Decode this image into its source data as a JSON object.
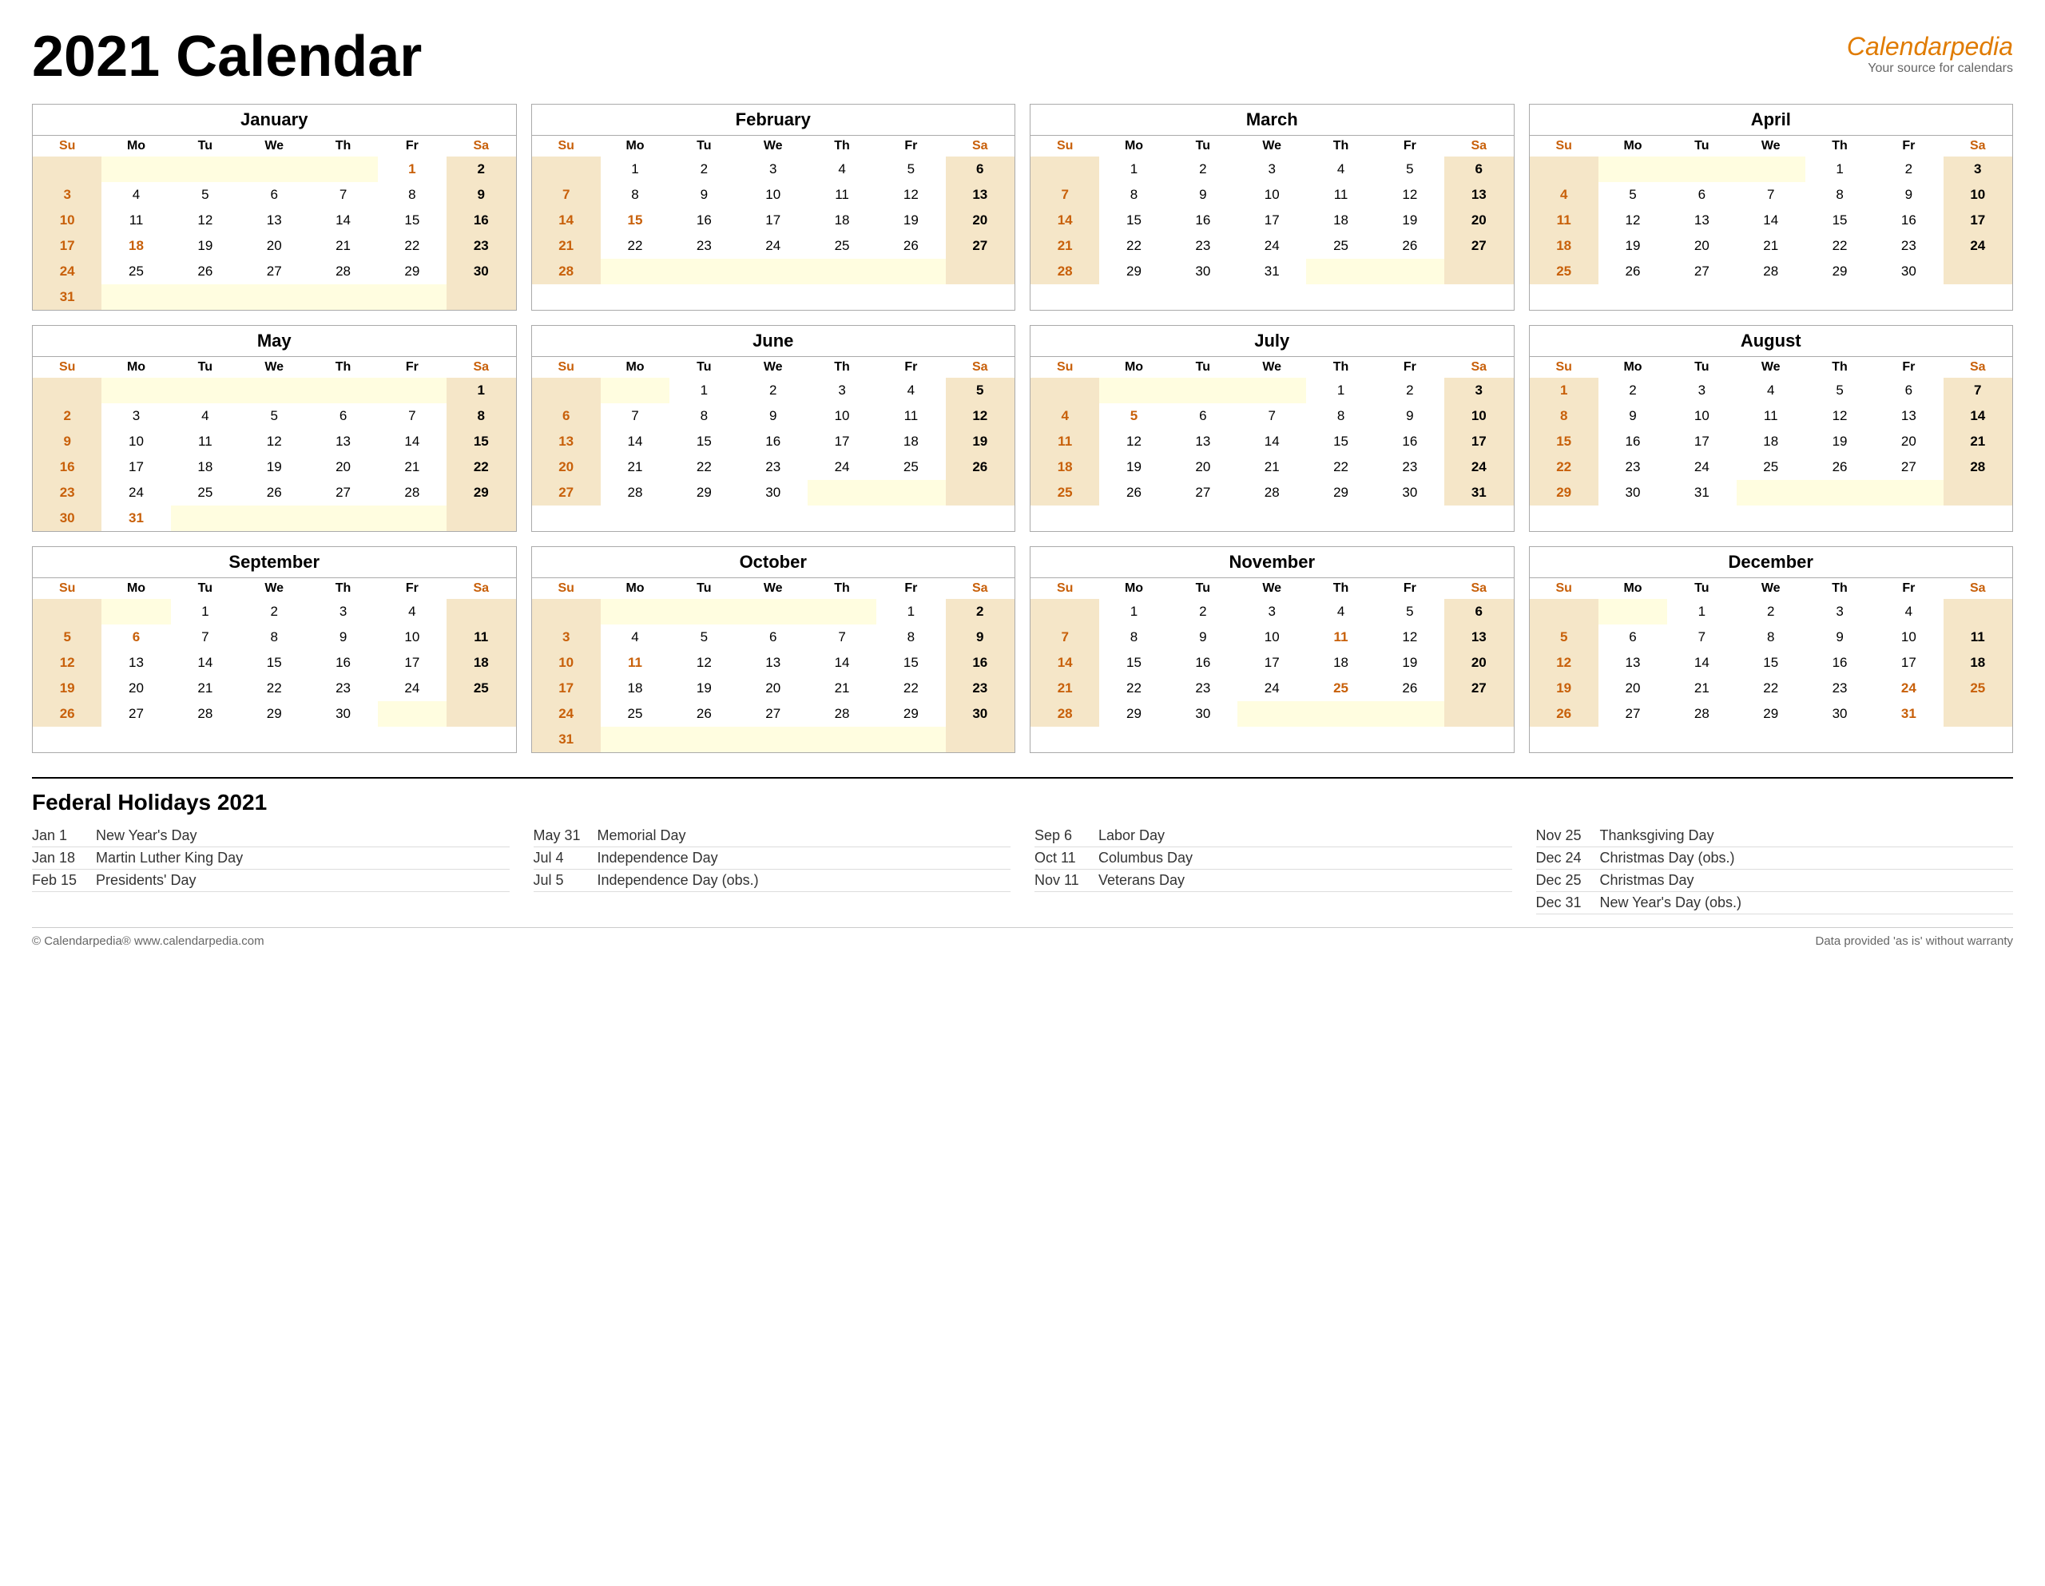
{
  "header": {
    "title": "2021 Calendar",
    "brand_name": "Calendar",
    "brand_italic": "pedia",
    "brand_sub": "Your source for calendars"
  },
  "months": [
    {
      "name": "January",
      "weeks": [
        [
          "",
          "",
          "",
          "",
          "",
          "1",
          "2"
        ],
        [
          "3",
          "4",
          "5",
          "6",
          "7",
          "8",
          "9"
        ],
        [
          "10",
          "11",
          "12",
          "13",
          "14",
          "15",
          "16"
        ],
        [
          "17",
          "18",
          "19",
          "20",
          "21",
          "22",
          "23"
        ],
        [
          "24",
          "25",
          "26",
          "27",
          "28",
          "29",
          "30"
        ],
        [
          "31",
          "",
          "",
          "",
          "",
          "",
          ""
        ]
      ],
      "holidays": {
        "1": "NY",
        "18": "MLK"
      }
    },
    {
      "name": "February",
      "weeks": [
        [
          "",
          "1",
          "2",
          "3",
          "4",
          "5",
          "6"
        ],
        [
          "7",
          "8",
          "9",
          "10",
          "11",
          "12",
          "13"
        ],
        [
          "14",
          "15",
          "16",
          "17",
          "18",
          "19",
          "20"
        ],
        [
          "21",
          "22",
          "23",
          "24",
          "25",
          "26",
          "27"
        ],
        [
          "28",
          "",
          "",
          "",
          "",
          "",
          ""
        ]
      ],
      "holidays": {
        "15": "PD"
      }
    },
    {
      "name": "March",
      "weeks": [
        [
          "",
          "1",
          "2",
          "3",
          "4",
          "5",
          "6"
        ],
        [
          "7",
          "8",
          "9",
          "10",
          "11",
          "12",
          "13"
        ],
        [
          "14",
          "15",
          "16",
          "17",
          "18",
          "19",
          "20"
        ],
        [
          "21",
          "22",
          "23",
          "24",
          "25",
          "26",
          "27"
        ],
        [
          "28",
          "29",
          "30",
          "31",
          "",
          "",
          ""
        ]
      ],
      "holidays": {}
    },
    {
      "name": "April",
      "weeks": [
        [
          "",
          "",
          "",
          "",
          "1",
          "2",
          "3"
        ],
        [
          "4",
          "5",
          "6",
          "7",
          "8",
          "9",
          "10"
        ],
        [
          "11",
          "12",
          "13",
          "14",
          "15",
          "16",
          "17"
        ],
        [
          "18",
          "19",
          "20",
          "21",
          "22",
          "23",
          "24"
        ],
        [
          "25",
          "26",
          "27",
          "28",
          "29",
          "30",
          ""
        ]
      ],
      "holidays": {}
    },
    {
      "name": "May",
      "weeks": [
        [
          "",
          "",
          "",
          "",
          "",
          "",
          "1"
        ],
        [
          "2",
          "3",
          "4",
          "5",
          "6",
          "7",
          "8"
        ],
        [
          "9",
          "10",
          "11",
          "12",
          "13",
          "14",
          "15"
        ],
        [
          "16",
          "17",
          "18",
          "19",
          "20",
          "21",
          "22"
        ],
        [
          "23",
          "24",
          "25",
          "26",
          "27",
          "28",
          "29"
        ],
        [
          "30",
          "31",
          "",
          "",
          "",
          "",
          ""
        ]
      ],
      "holidays": {
        "31": "MD"
      }
    },
    {
      "name": "June",
      "weeks": [
        [
          "",
          "",
          "1",
          "2",
          "3",
          "4",
          "5"
        ],
        [
          "6",
          "7",
          "8",
          "9",
          "10",
          "11",
          "12"
        ],
        [
          "13",
          "14",
          "15",
          "16",
          "17",
          "18",
          "19"
        ],
        [
          "20",
          "21",
          "22",
          "23",
          "24",
          "25",
          "26"
        ],
        [
          "27",
          "28",
          "29",
          "30",
          "",
          "",
          ""
        ]
      ],
      "holidays": {}
    },
    {
      "name": "July",
      "weeks": [
        [
          "",
          "",
          "",
          "",
          "1",
          "2",
          "3"
        ],
        [
          "4",
          "5",
          "6",
          "7",
          "8",
          "9",
          "10"
        ],
        [
          "11",
          "12",
          "13",
          "14",
          "15",
          "16",
          "17"
        ],
        [
          "18",
          "19",
          "20",
          "21",
          "22",
          "23",
          "24"
        ],
        [
          "25",
          "26",
          "27",
          "28",
          "29",
          "30",
          "31"
        ]
      ],
      "holidays": {
        "4": "ID",
        "5": "IDO"
      }
    },
    {
      "name": "August",
      "weeks": [
        [
          "1",
          "2",
          "3",
          "4",
          "5",
          "6",
          "7"
        ],
        [
          "8",
          "9",
          "10",
          "11",
          "12",
          "13",
          "14"
        ],
        [
          "15",
          "16",
          "17",
          "18",
          "19",
          "20",
          "21"
        ],
        [
          "22",
          "23",
          "24",
          "25",
          "26",
          "27",
          "28"
        ],
        [
          "29",
          "30",
          "31",
          "",
          "",
          "",
          ""
        ]
      ],
      "holidays": {}
    },
    {
      "name": "September",
      "weeks": [
        [
          "",
          "",
          "1",
          "2",
          "3",
          "4",
          ""
        ],
        [
          "5",
          "6",
          "7",
          "8",
          "9",
          "10",
          "11"
        ],
        [
          "12",
          "13",
          "14",
          "15",
          "16",
          "17",
          "18"
        ],
        [
          "19",
          "20",
          "21",
          "22",
          "23",
          "24",
          "25"
        ],
        [
          "26",
          "27",
          "28",
          "29",
          "30",
          "",
          ""
        ]
      ],
      "holidays": {
        "6": "LD"
      }
    },
    {
      "name": "October",
      "weeks": [
        [
          "",
          "",
          "",
          "",
          "",
          "1",
          "2"
        ],
        [
          "3",
          "4",
          "5",
          "6",
          "7",
          "8",
          "9"
        ],
        [
          "10",
          "11",
          "12",
          "13",
          "14",
          "15",
          "16"
        ],
        [
          "17",
          "18",
          "19",
          "20",
          "21",
          "22",
          "23"
        ],
        [
          "24",
          "25",
          "26",
          "27",
          "28",
          "29",
          "30"
        ],
        [
          "31",
          "",
          "",
          "",
          "",
          "",
          ""
        ]
      ],
      "holidays": {
        "11": "CD"
      }
    },
    {
      "name": "November",
      "weeks": [
        [
          "",
          "1",
          "2",
          "3",
          "4",
          "5",
          "6"
        ],
        [
          "7",
          "8",
          "9",
          "10",
          "11",
          "12",
          "13"
        ],
        [
          "14",
          "15",
          "16",
          "17",
          "18",
          "19",
          "20"
        ],
        [
          "21",
          "22",
          "23",
          "24",
          "25",
          "26",
          "27"
        ],
        [
          "28",
          "29",
          "30",
          "",
          "",
          "",
          ""
        ]
      ],
      "holidays": {
        "11": "VD",
        "25": "TGD"
      }
    },
    {
      "name": "December",
      "weeks": [
        [
          "",
          "",
          "1",
          "2",
          "3",
          "4",
          ""
        ],
        [
          "5",
          "6",
          "7",
          "8",
          "9",
          "10",
          "11"
        ],
        [
          "12",
          "13",
          "14",
          "15",
          "16",
          "17",
          "18"
        ],
        [
          "19",
          "20",
          "21",
          "22",
          "23",
          "24",
          "25"
        ],
        [
          "26",
          "27",
          "28",
          "29",
          "30",
          "31",
          ""
        ]
      ],
      "holidays": {
        "24": "CDO",
        "25": "CD2",
        "31": "NYDO"
      }
    }
  ],
  "day_headers": [
    "Su",
    "Mo",
    "Tu",
    "We",
    "Th",
    "Fr",
    "Sa"
  ],
  "holidays_section": {
    "title": "Federal Holidays 2021",
    "columns": [
      [
        {
          "date": "Jan 1",
          "name": "New Year's Day"
        },
        {
          "date": "Jan 18",
          "name": "Martin Luther King Day"
        },
        {
          "date": "Feb 15",
          "name": "Presidents' Day"
        }
      ],
      [
        {
          "date": "May 31",
          "name": "Memorial Day"
        },
        {
          "date": "Jul 4",
          "name": "Independence Day"
        },
        {
          "date": "Jul 5",
          "name": "Independence Day (obs.)"
        }
      ],
      [
        {
          "date": "Sep 6",
          "name": "Labor Day"
        },
        {
          "date": "Oct 11",
          "name": "Columbus Day"
        },
        {
          "date": "Nov 11",
          "name": "Veterans Day"
        }
      ],
      [
        {
          "date": "Nov 25",
          "name": "Thanksgiving Day"
        },
        {
          "date": "Dec 24",
          "name": "Christmas Day (obs.)"
        },
        {
          "date": "Dec 25",
          "name": "Christmas Day"
        },
        {
          "date": "Dec 31",
          "name": "New Year's Day (obs.)"
        }
      ]
    ]
  },
  "footer": {
    "left": "© Calendarpedia®  www.calendarpedia.com",
    "right": "Data provided 'as is' without warranty"
  }
}
